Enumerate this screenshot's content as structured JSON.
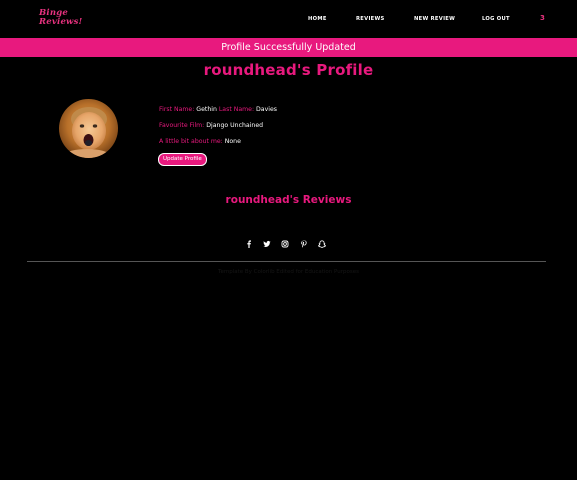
{
  "brand": {
    "line1": "Binge",
    "line2": "Reviews!"
  },
  "nav": {
    "home": "HOME",
    "reviews": "REVIEWS",
    "new_review": "NEW REVIEW",
    "logout": "LOG OUT",
    "count": "3"
  },
  "banner": {
    "message": "Profile Successfully Updated"
  },
  "profile": {
    "title": "roundhead's Profile",
    "first_name_label": "First Name:",
    "first_name": "Gethin",
    "last_name_label": "Last Name:",
    "last_name": "Davies",
    "film_label": "Favourite Film:",
    "film": "Django Unchained",
    "about_label": "A little bit about me:",
    "about": "None",
    "update_button": "Update Profile"
  },
  "reviews": {
    "title": "roundhead's Reviews"
  },
  "social": [
    "facebook-icon",
    "twitter-icon",
    "instagram-icon",
    "pinterest-icon",
    "snapchat-icon"
  ],
  "footer": {
    "text": "Template By Colorlib Edited for Education Purposes"
  },
  "colors": {
    "accent": "#e8197e",
    "background": "#000000"
  }
}
